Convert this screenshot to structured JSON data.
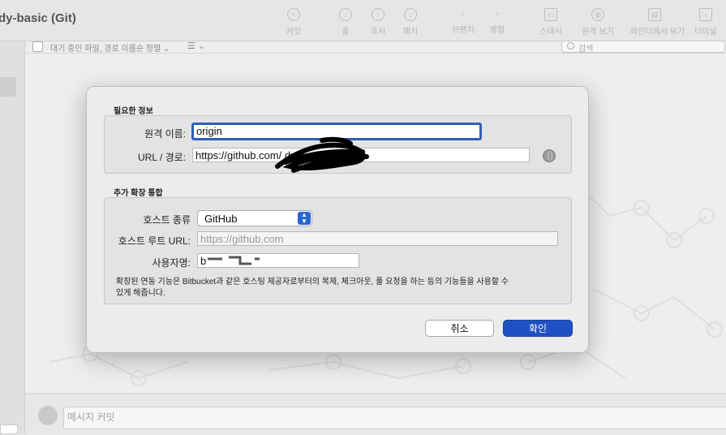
{
  "window": {
    "title": "dy-basic (Git)"
  },
  "toolbar": {
    "items": [
      {
        "label": "커밋",
        "icon": "commit-icon"
      },
      {
        "label": "풀",
        "icon": "pull-icon"
      },
      {
        "label": "푸시",
        "icon": "push-icon"
      },
      {
        "label": "패치",
        "icon": "fetch-icon"
      },
      {
        "label": "브랜치",
        "icon": "branch-icon"
      },
      {
        "label": "병합",
        "icon": "merge-icon"
      },
      {
        "label": "스태시",
        "icon": "stash-icon"
      },
      {
        "label": "원격 보기",
        "icon": "globe-icon"
      },
      {
        "label": "파인더에서 보기",
        "icon": "finder-icon"
      },
      {
        "label": "터미널",
        "icon": "terminal-icon"
      }
    ]
  },
  "filterbar": {
    "pending_label": "대기 중인 파일, 경로 이름순 정렬 ⌄",
    "menu_label": "☰ ⌄",
    "search_placeholder": "검색"
  },
  "commit": {
    "placeholder": "메시지 커밋"
  },
  "dialog": {
    "required_section": "필요한 정보",
    "remote_name_label": "원격 이름:",
    "remote_name_value": "origin",
    "url_label": "URL / 경로:",
    "url_value": "https://github.com/               dy-basic.git",
    "integration_section": "추가 확장 통합",
    "host_type_label": "호스트 종류",
    "host_type_value": "GitHub",
    "host_root_label": "호스트 루트 URL:",
    "host_root_placeholder": "https://github.com",
    "username_label": "사용자명:",
    "username_value": "b",
    "description_line1": "확장된 연동 기능은 Bitbucket과 같은 호스팅 제공자로부터의 복제, 체크아웃, 풀 요청을 하는 등의 기능들을 사용할 수",
    "description_line2": "있게 해줍니다.",
    "cancel_label": "취소",
    "ok_label": "확인"
  },
  "colors": {
    "accent": "#1f50c4",
    "select_accent": "#2867d3"
  }
}
